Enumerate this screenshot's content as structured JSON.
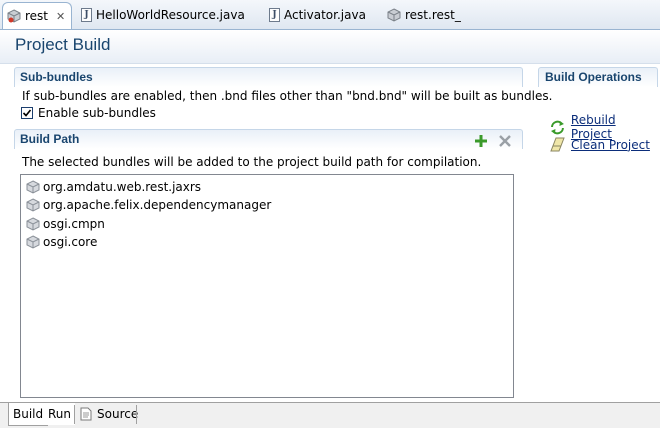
{
  "tabs": [
    {
      "label": "rest",
      "icon": "bundle-icon",
      "active": true
    },
    {
      "label": "HelloWorldResource.java",
      "icon": "java-file-icon"
    },
    {
      "label": "Activator.java",
      "icon": "java-file-icon"
    },
    {
      "label": "rest.rest_",
      "icon": "bundle-icon"
    }
  ],
  "java_icon_letter": "J",
  "close_glyph": "✕",
  "form": {
    "title": "Project Build"
  },
  "subbundles": {
    "title": "Sub-bundles",
    "description": "If sub-bundles are enabled, then .bnd files other than \"bnd.bnd\" will be built as bundles.",
    "checkbox_label": "Enable sub-bundles",
    "checked": true
  },
  "buildpath": {
    "title": "Build Path",
    "description": "The selected bundles will be added to the project build path for compilation.",
    "add_icon": "add-icon",
    "remove_icon": "remove-icon",
    "bundles": [
      "org.amdatu.web.rest.jaxrs",
      "org.apache.felix.dependencymanager",
      "osgi.cmpn",
      "osgi.core"
    ]
  },
  "operations": {
    "title": "Build Operations",
    "rebuild_label": "Rebuild Project",
    "clean_label": "Clean Project"
  },
  "bottom_tabs": [
    {
      "label": "Build",
      "active": true
    },
    {
      "label": "Run"
    },
    {
      "label": "Source",
      "icon": "source-file-icon"
    }
  ],
  "colors": {
    "section_title": "#19456e",
    "link": "#0b2d7a",
    "add_green": "#3a9a2a"
  }
}
